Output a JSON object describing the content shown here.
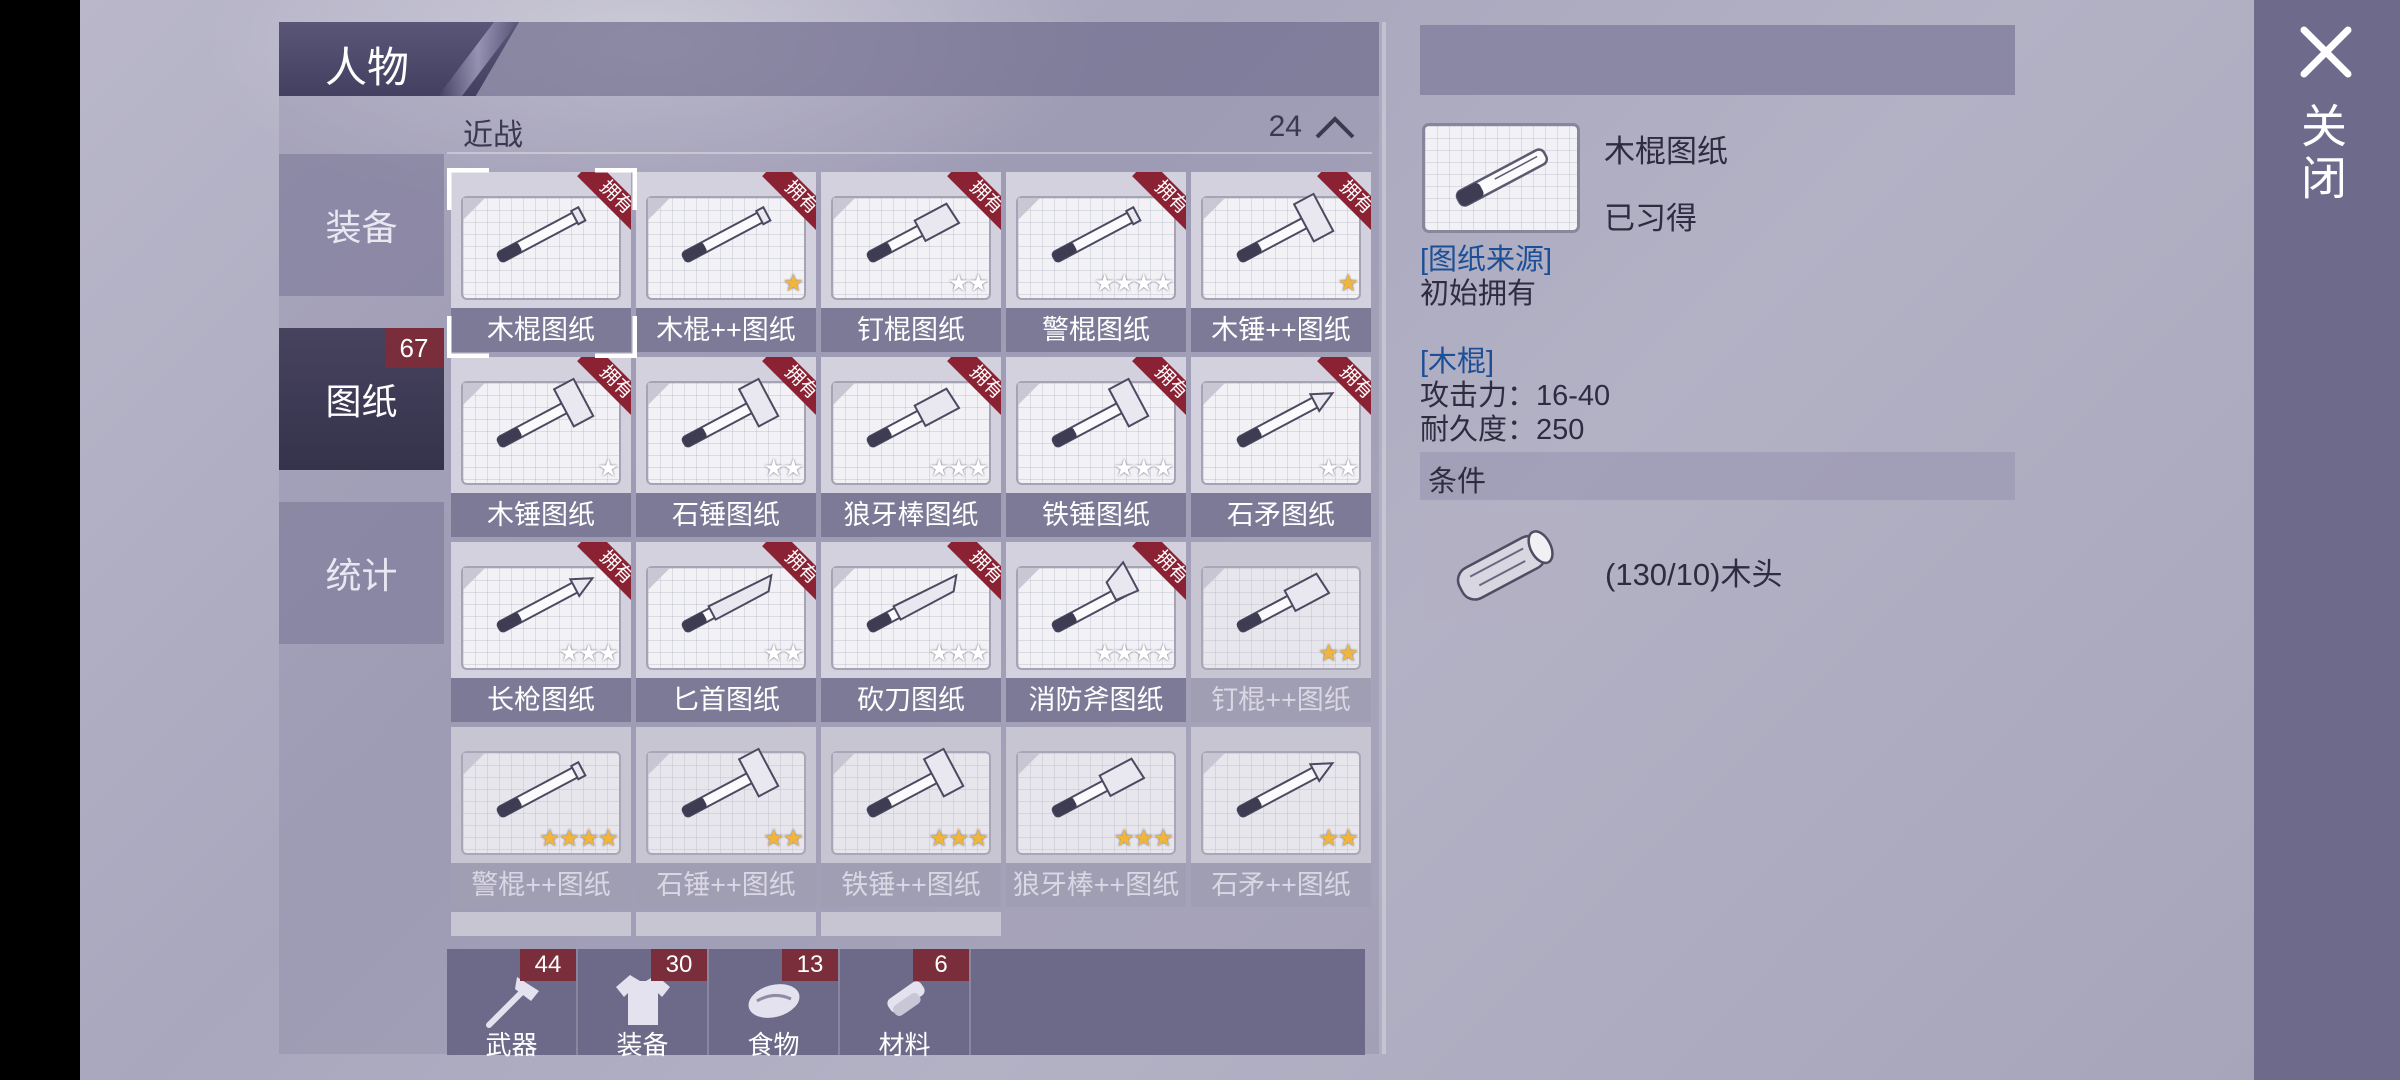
{
  "header": {
    "title": "人物"
  },
  "close_button": {
    "label": "关闭",
    "icon": "close-icon"
  },
  "side_tabs": [
    {
      "label": "装备",
      "active": false
    },
    {
      "label": "图纸",
      "active": true,
      "badge": "67"
    },
    {
      "label": "统计",
      "active": false
    }
  ],
  "section": {
    "label": "近战",
    "count": "24",
    "icon": "chevron-up-icon"
  },
  "owned_label": "拥有",
  "cards": [
    {
      "label": "木棍图纸",
      "owned": true,
      "stars": 0,
      "star_color": "white",
      "icon": "wooden-stick-icon",
      "selected": true
    },
    {
      "label": "木棍++图纸",
      "owned": true,
      "stars": 1,
      "star_color": "gold",
      "icon": "wrapped-stick-icon"
    },
    {
      "label": "钉棍图纸",
      "owned": true,
      "stars": 2,
      "star_color": "white",
      "icon": "nail-club-icon"
    },
    {
      "label": "警棍图纸",
      "owned": true,
      "stars": 4,
      "star_color": "white",
      "icon": "baton-icon"
    },
    {
      "label": "木锤++图纸",
      "owned": true,
      "stars": 1,
      "star_color": "gold",
      "icon": "hammer-icon"
    },
    {
      "label": "木锤图纸",
      "owned": true,
      "stars": 1,
      "star_color": "white",
      "icon": "wooden-hammer-icon"
    },
    {
      "label": "石锤图纸",
      "owned": true,
      "stars": 2,
      "star_color": "white",
      "icon": "stone-hammer-icon"
    },
    {
      "label": "狼牙棒图纸",
      "owned": true,
      "stars": 3,
      "star_color": "white",
      "icon": "spiked-club-icon"
    },
    {
      "label": "铁锤图纸",
      "owned": true,
      "stars": 3,
      "star_color": "white",
      "icon": "iron-hammer-icon"
    },
    {
      "label": "石矛图纸",
      "owned": true,
      "stars": 2,
      "star_color": "white",
      "icon": "stone-spear-icon"
    },
    {
      "label": "长枪图纸",
      "owned": true,
      "stars": 3,
      "star_color": "white",
      "icon": "long-spear-icon"
    },
    {
      "label": "匕首图纸",
      "owned": true,
      "stars": 2,
      "star_color": "white",
      "icon": "dagger-icon"
    },
    {
      "label": "砍刀图纸",
      "owned": true,
      "stars": 3,
      "star_color": "white",
      "icon": "machete-icon"
    },
    {
      "label": "消防斧图纸",
      "owned": true,
      "stars": 4,
      "star_color": "white",
      "icon": "fire-axe-icon"
    },
    {
      "label": "钉棍++图纸",
      "owned": false,
      "stars": 2,
      "star_color": "gold",
      "icon": "nail-club-icon"
    },
    {
      "label": "警棍++图纸",
      "owned": false,
      "stars": 4,
      "star_color": "gold",
      "icon": "baton-icon"
    },
    {
      "label": "石锤++图纸",
      "owned": false,
      "stars": 2,
      "star_color": "gold",
      "icon": "stone-hammer-icon"
    },
    {
      "label": "铁锤++图纸",
      "owned": false,
      "stars": 3,
      "star_color": "gold",
      "icon": "iron-hammer-icon"
    },
    {
      "label": "狼牙棒++图纸",
      "owned": false,
      "stars": 3,
      "star_color": "gold",
      "icon": "spiked-club-icon"
    },
    {
      "label": "石矛++图纸",
      "owned": false,
      "stars": 2,
      "star_color": "gold",
      "icon": "stone-spear-icon"
    }
  ],
  "bottom_tabs": [
    {
      "label": "武器",
      "badge": "44",
      "icon": "axe-icon"
    },
    {
      "label": "装备",
      "badge": "30",
      "icon": "shirt-icon"
    },
    {
      "label": "食物",
      "badge": "13",
      "icon": "food-icon"
    },
    {
      "label": "材料",
      "badge": "6",
      "icon": "material-icon"
    }
  ],
  "detail": {
    "name": "木棍图纸",
    "status": "已习得",
    "source_label": "[图纸来源]",
    "source_value": "初始拥有",
    "item_label": "[木棍]",
    "attack": "攻击力：16-40",
    "durability": "耐久度：250",
    "conditions_label": "条件",
    "material": "(130/10)木头",
    "material_icon": "wood-log-icon"
  },
  "colors": {
    "owned_ribbon": "#8a2233",
    "badge": "#7a2d3a",
    "gold_star": "#f0b53a",
    "link_blue": "#1d4f96"
  }
}
